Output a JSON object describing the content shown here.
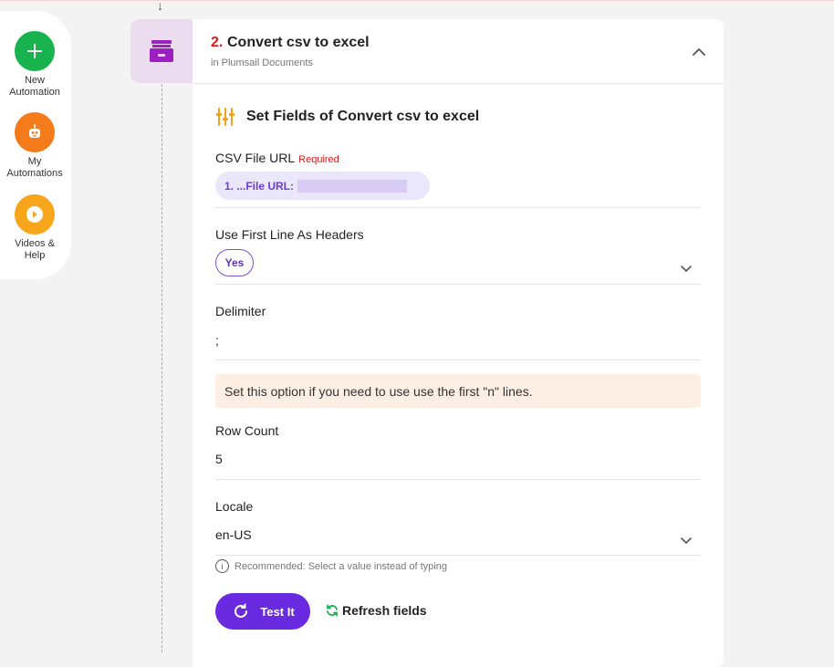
{
  "sidebar": {
    "items": [
      {
        "label_line1": "New",
        "label_line2": "Automation",
        "icon": "plus-icon",
        "color": "#18b34f"
      },
      {
        "label_line1": "My",
        "label_line2": "Automations",
        "icon": "robot-icon",
        "color": "#f57a1a"
      },
      {
        "label_line1": "Videos &",
        "label_line2": "Help",
        "icon": "play-icon",
        "color": "#f7a51b"
      }
    ]
  },
  "step": {
    "number": "2.",
    "title": "Convert csv to excel",
    "subtitle": "in Plumsail Documents",
    "icon": "archive-box-icon"
  },
  "section": {
    "title": "Set Fields of Convert csv to excel",
    "icon": "sliders-icon"
  },
  "fields": {
    "csv_url": {
      "label": "CSV File URL",
      "required": "Required",
      "value": "1. ...File URL:"
    },
    "first_line_headers": {
      "label": "Use First Line As Headers",
      "value": "Yes"
    },
    "delimiter": {
      "label": "Delimiter",
      "value": ";"
    },
    "hint": "Set this option if you need to use use the first \"n\" lines.",
    "row_count": {
      "label": "Row Count",
      "value": "5"
    },
    "locale": {
      "label": "Locale",
      "value": "en-US",
      "recommendation": "Recommended: Select a value instead of typing"
    }
  },
  "actions": {
    "test_label": "Test It",
    "refresh_label": "Refresh fields"
  },
  "colors": {
    "accent": "#6a2be0",
    "step_number": "#d81b1b",
    "refresh_green": "#18b34f"
  }
}
